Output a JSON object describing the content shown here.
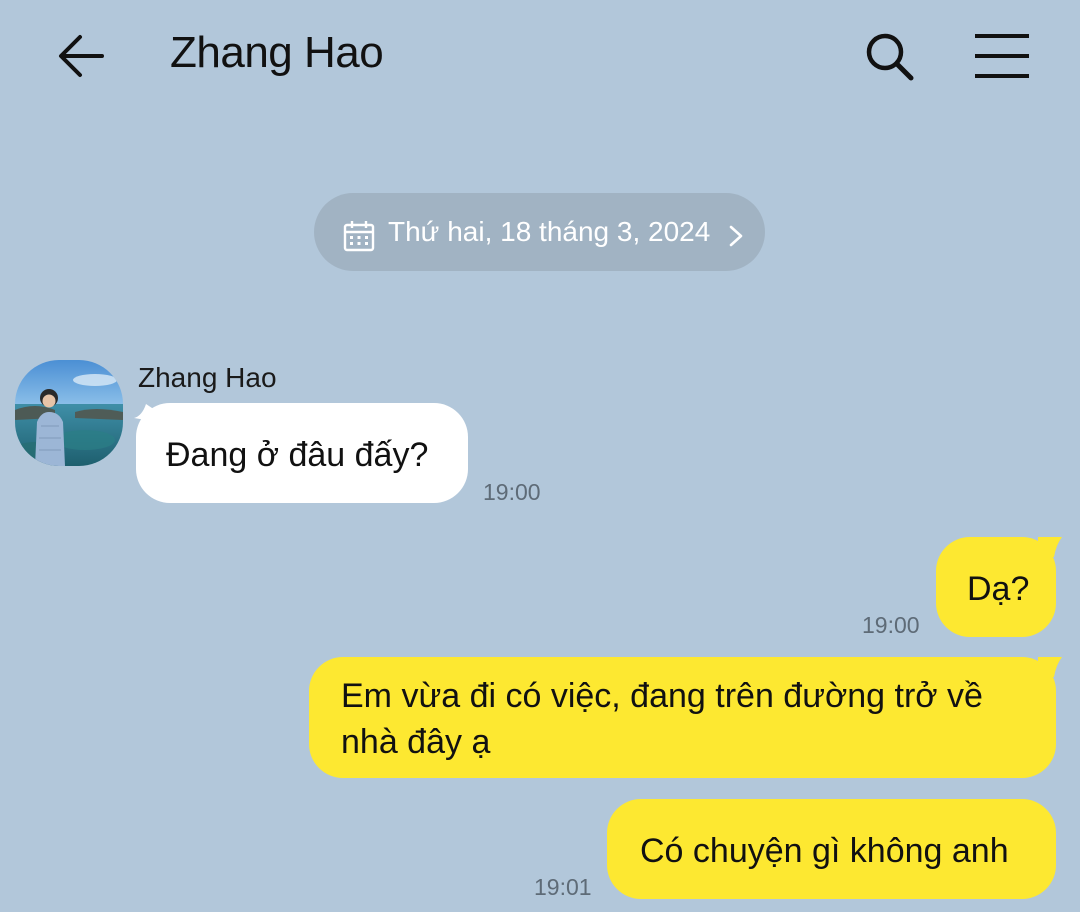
{
  "header": {
    "title": "Zhang Hao",
    "back_icon": "arrow-left-icon",
    "search_icon": "search-icon",
    "menu_icon": "hamburger-menu-icon"
  },
  "date_separator": {
    "icon": "calendar-icon",
    "text": "Thứ hai, 18 tháng 3, 2024",
    "chevron_icon": "chevron-right-icon"
  },
  "messages": [
    {
      "direction": "incoming",
      "sender": "Zhang Hao",
      "text": "Đang ở đâu đấy?",
      "time": "19:00"
    },
    {
      "direction": "outgoing",
      "text": "Dạ?",
      "time": "19:00"
    },
    {
      "direction": "outgoing",
      "text": "Em vừa đi có việc, đang trên đường trở về nhà đây ạ",
      "line1": "Em vừa đi có việc, đang trên đường trở về",
      "line2": "nhà đây ạ"
    },
    {
      "direction": "outgoing",
      "text": "Có chuyện gì không anh",
      "time": "19:01"
    }
  ],
  "colors": {
    "background": "#b2c7da",
    "incoming_bubble": "#ffffff",
    "outgoing_bubble": "#fde831",
    "date_pill": "#a1b3c3",
    "timestamp": "#5e6b77"
  }
}
